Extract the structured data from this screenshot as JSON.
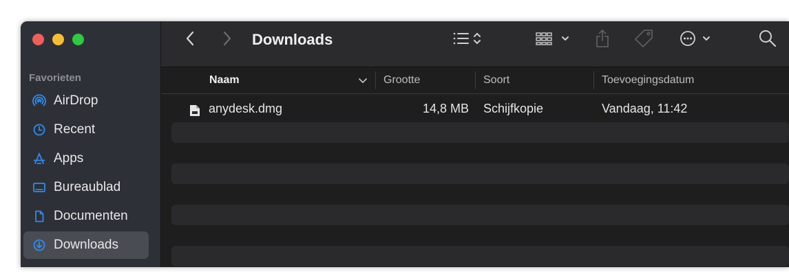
{
  "window": {
    "title": "Downloads"
  },
  "sidebar": {
    "section_label": "Favorieten",
    "items": [
      {
        "label": "AirDrop",
        "icon": "airdrop-icon"
      },
      {
        "label": "Recent",
        "icon": "clock-icon"
      },
      {
        "label": "Apps",
        "icon": "apps-icon"
      },
      {
        "label": "Bureaublad",
        "icon": "desktop-icon"
      },
      {
        "label": "Documenten",
        "icon": "document-icon"
      },
      {
        "label": "Downloads",
        "icon": "download-circle-icon",
        "selected": true
      }
    ]
  },
  "toolbar": {
    "back_icon": "chevron-left-icon",
    "forward_icon": "chevron-right-icon",
    "view_icon": "list-view-icon",
    "group_icon": "grid-group-icon",
    "share_icon": "share-icon",
    "tag_icon": "tag-icon",
    "more_icon": "ellipsis-circle-icon",
    "search_icon": "search-icon"
  },
  "columns": {
    "name": "Naam",
    "size": "Grootte",
    "kind": "Soort",
    "date_added": "Toevoegingsdatum"
  },
  "files": [
    {
      "name": "anydesk.dmg",
      "size": "14,8 MB",
      "kind": "Schijfkopie",
      "date_added": "Vandaag, 11:42"
    }
  ],
  "colors": {
    "accent": "#2d8cf0",
    "traffic_red": "#ee5f58",
    "traffic_yellow": "#f7be34",
    "traffic_green": "#2ec945"
  }
}
